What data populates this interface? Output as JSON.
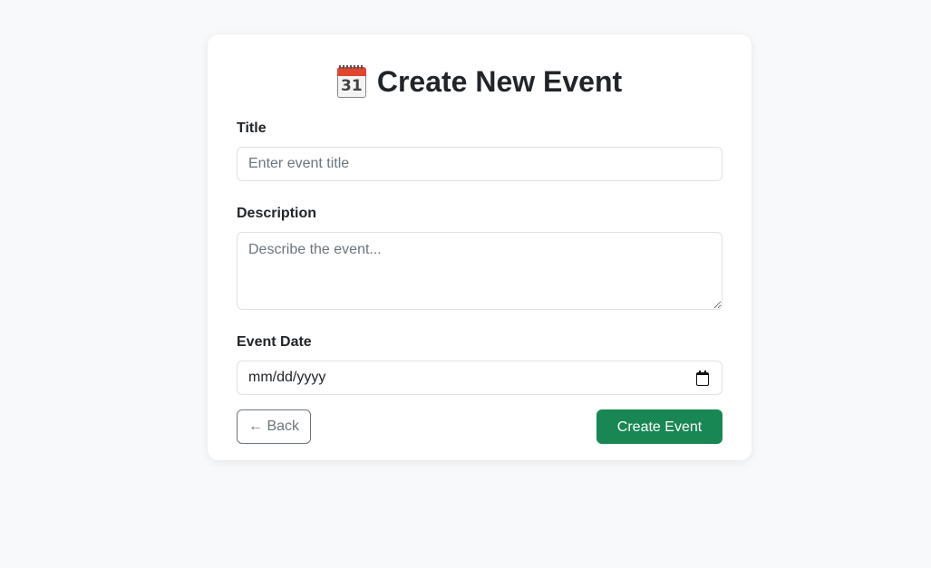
{
  "form": {
    "heading": "Create New Event",
    "heading_icon": "calendar-icon",
    "calendar_day": "31",
    "title_label": "Title",
    "title_placeholder": "Enter event title",
    "title_value": "",
    "description_label": "Description",
    "description_placeholder": "Describe the event...",
    "description_value": "",
    "date_label": "Event Date",
    "date_placeholder": "mm/dd/yyyy",
    "date_icon": "calendar-picker-icon",
    "back_label": "← Back",
    "submit_label": "Create Event"
  },
  "colors": {
    "background": "#f8f9fa",
    "card": "#ffffff",
    "primary_success": "#198754",
    "secondary": "#6c757d"
  }
}
